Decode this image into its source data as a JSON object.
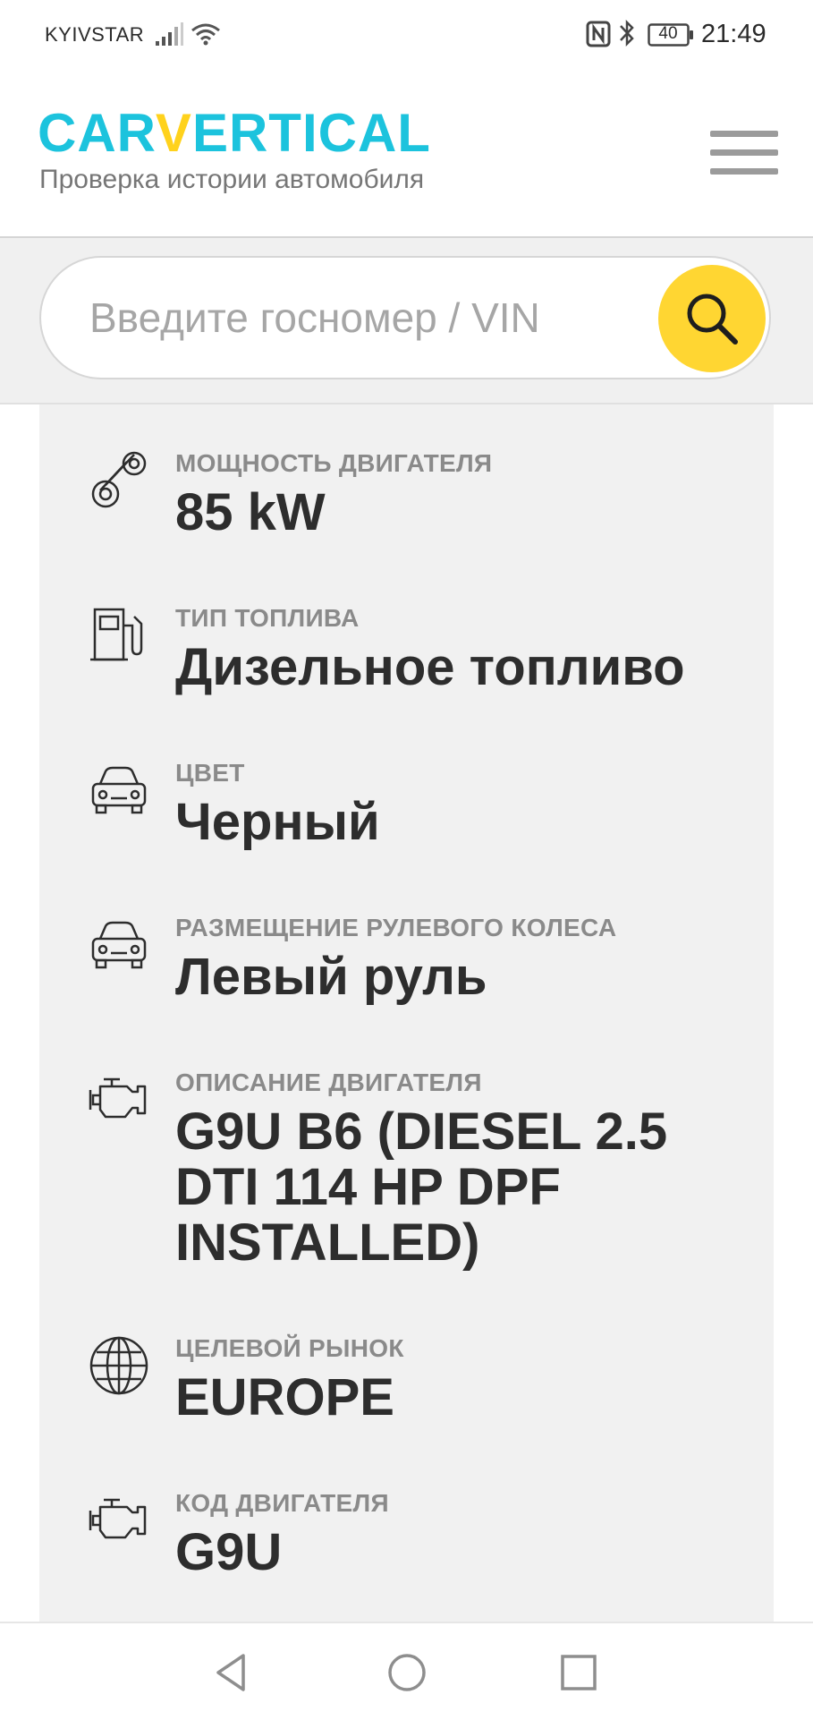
{
  "status_bar": {
    "carrier": "KYIVSTAR",
    "battery": "40",
    "time": "21:49"
  },
  "header": {
    "logo_left": "CAR",
    "logo_mark": "V",
    "logo_right": "ERTICAL",
    "tagline": "Проверка истории автомобиля",
    "menu_icon": "hamburger-menu-icon"
  },
  "search": {
    "placeholder": "Введите госномер / VIN",
    "value": "",
    "icon": "search-icon",
    "accent_color": "#ffd632"
  },
  "details": [
    {
      "icon": "engine-belt-icon",
      "label": "МОЩНОСТЬ ДВИГАТЕЛЯ",
      "value": "85 kW"
    },
    {
      "icon": "fuel-pump-icon",
      "label": "ТИП ТОПЛИВА",
      "value": "Дизельное топливо"
    },
    {
      "icon": "car-front-icon",
      "label": "ЦВЕТ",
      "value": "Черный"
    },
    {
      "icon": "car-front-icon",
      "label": "РАЗМЕЩЕНИЕ РУЛЕВОГО КОЛЕСА",
      "value": "Левый руль"
    },
    {
      "icon": "engine-icon",
      "label": "ОПИСАНИЕ ДВИГАТЕЛЯ",
      "value": "G9U B6 (DIESEL 2.5 DTI 114 HP DPF INSTALLED)"
    },
    {
      "icon": "globe-icon",
      "label": "ЦЕЛЕВОЙ РЫНОК",
      "value": "EUROPE"
    },
    {
      "icon": "engine-icon",
      "label": "КОД ДВИГАТЕЛЯ",
      "value": "G9U"
    }
  ],
  "colors": {
    "brand_cyan": "#1cc3dd",
    "brand_yellow": "#ffd21c"
  }
}
